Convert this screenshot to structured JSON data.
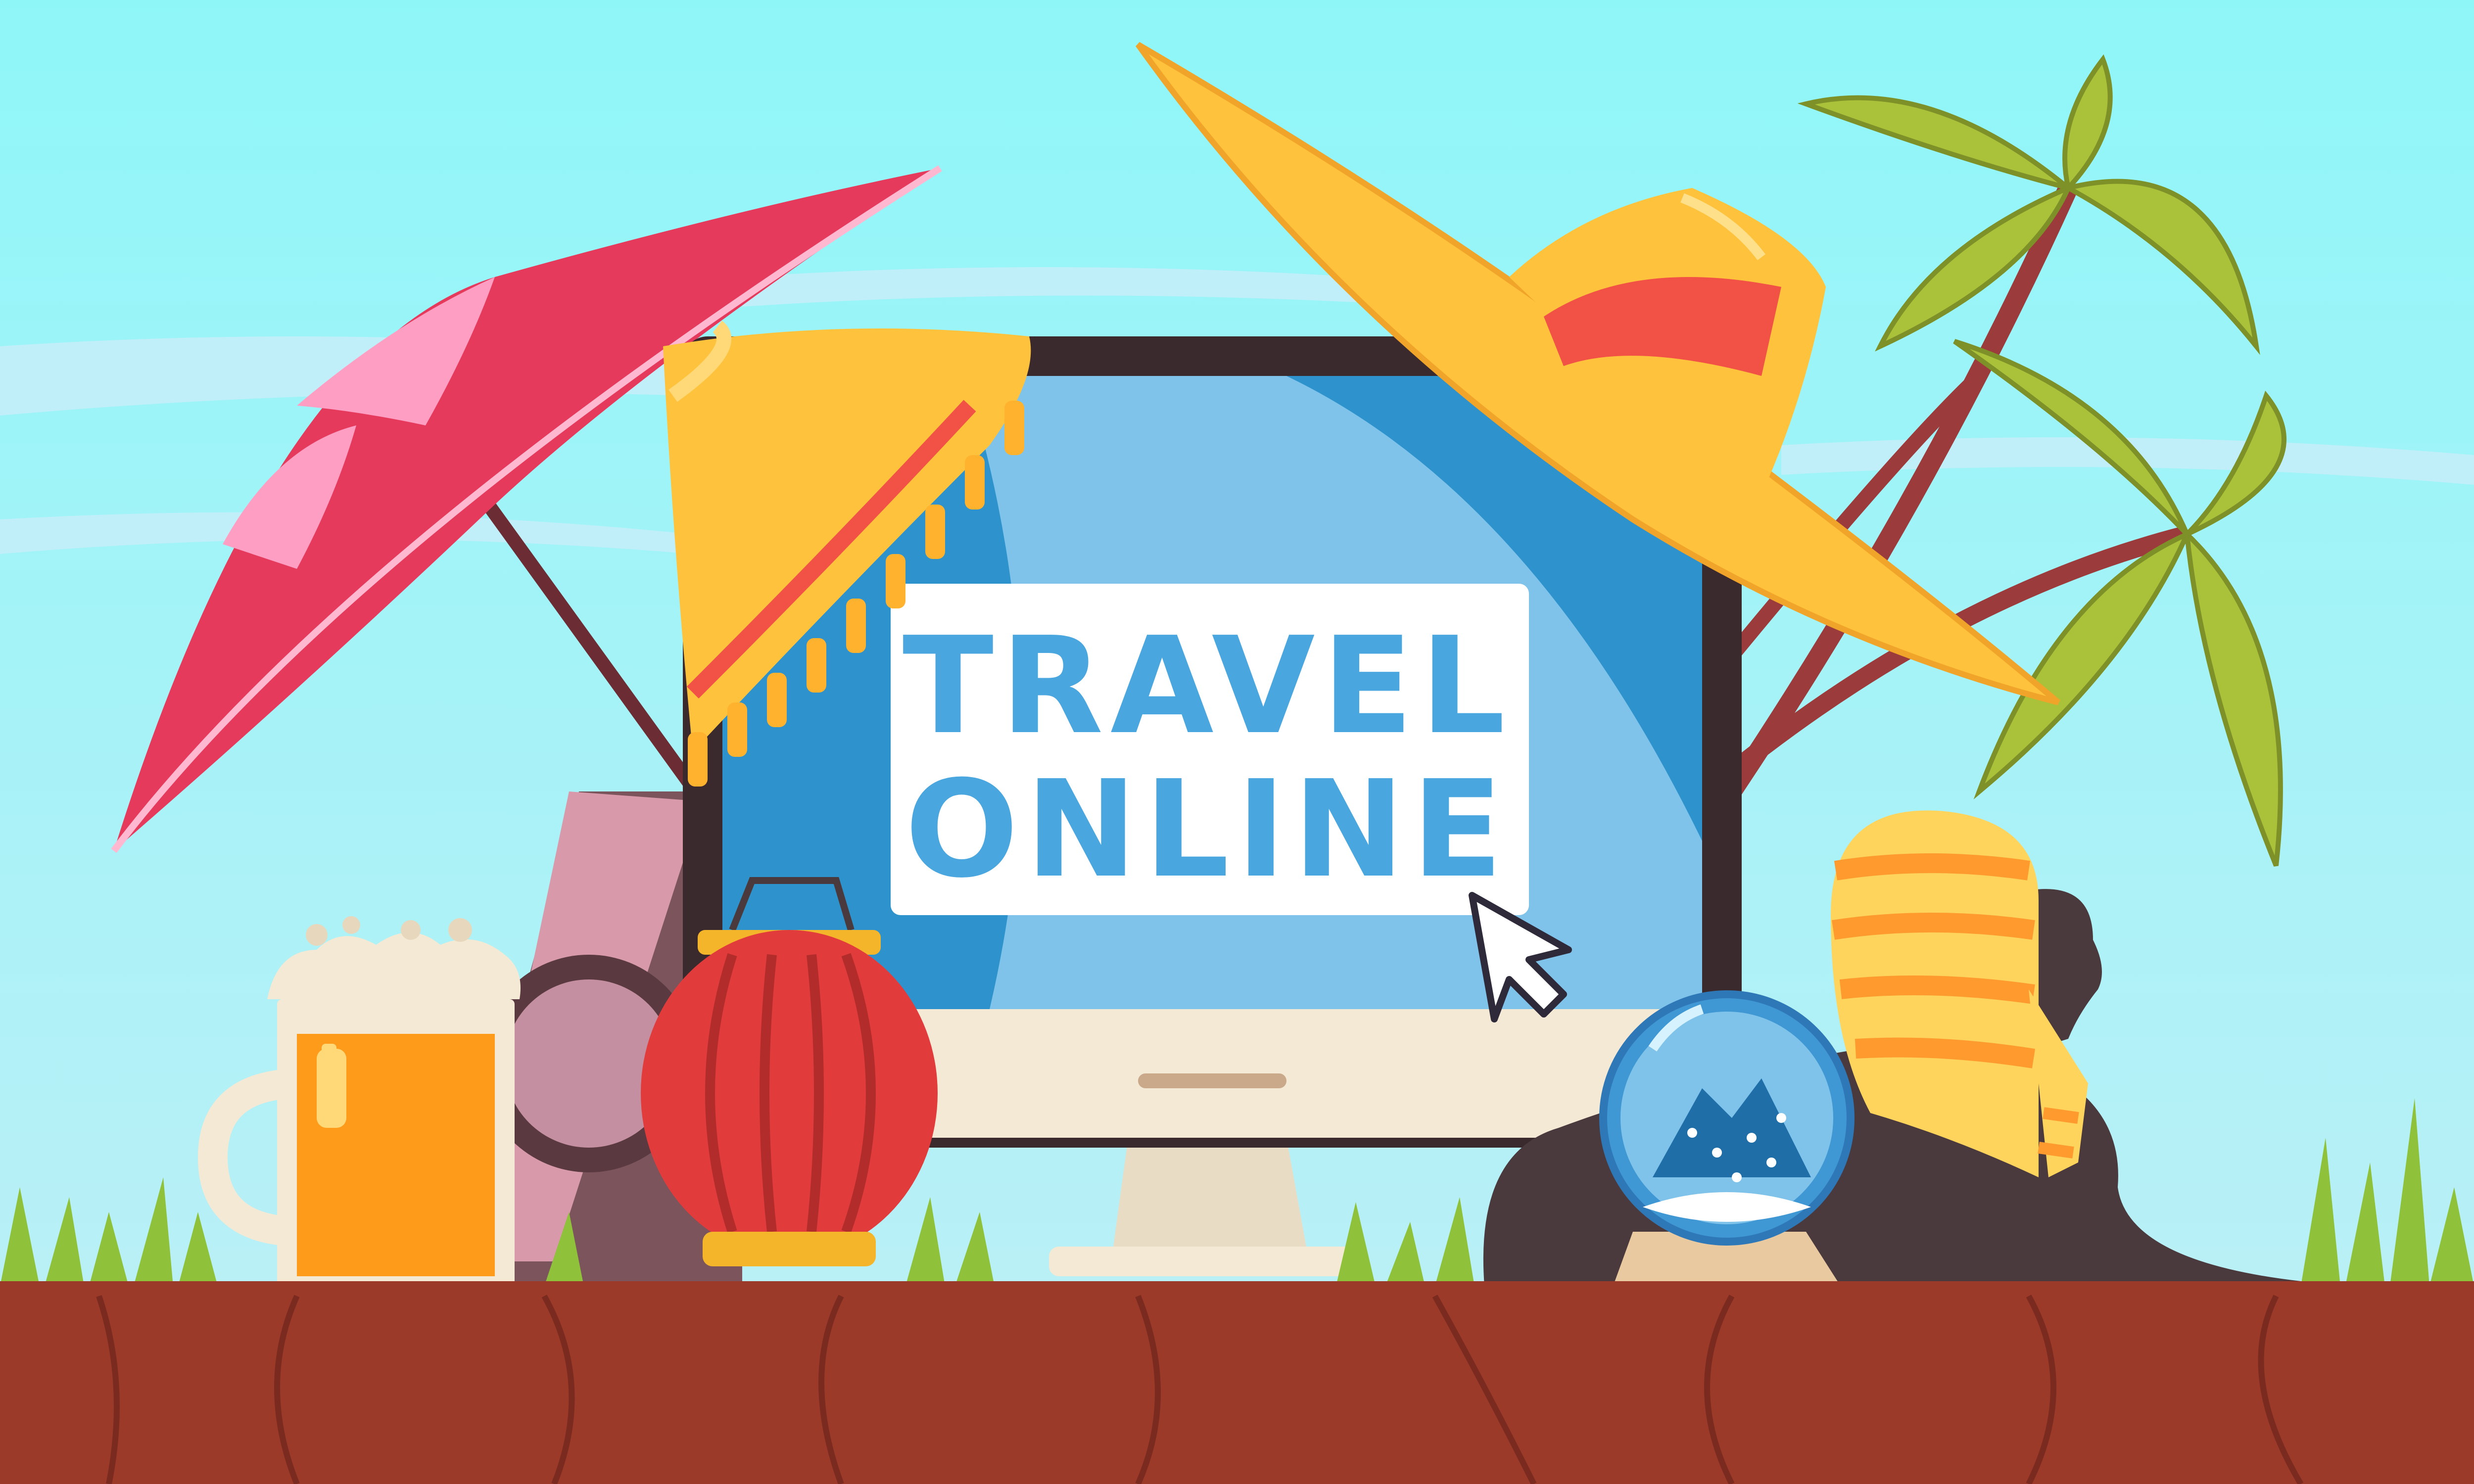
{
  "screen": {
    "line1": "TRAVEL",
    "line2": "ONLINE"
  },
  "colors": {
    "sky_top": "#8ff6f8",
    "sky_bottom": "#b9f0f6",
    "ground": "#9c3a2a",
    "ground_lines": "#7a2a1f",
    "grass": "#8fc23a",
    "monitor_frame": "#3b2a2d",
    "screen_blue": "#2e93cc",
    "screen_light": "#7fc3ea",
    "text_box": "#ffffff",
    "text_blue": "#4aa6de",
    "umbrella_red": "#e63a5c",
    "umbrella_pink": "#ff9ec3",
    "hat_yellow": "#ffc23d",
    "hat_band": "#f25245",
    "palm_leaf": "#a9c23a",
    "lantern_red": "#e23b3b",
    "beer_orange": "#ff9b1a",
    "globe_blue": "#3f97d3",
    "sphinx_dark": "#4a3a3d",
    "headdress_orange": "#ff9a2e"
  },
  "icons": {
    "cursor": "arrow-cursor-icon",
    "umbrella": "beach-umbrella-icon",
    "hat": "sun-hat-icon",
    "palm": "palm-tree-icon",
    "beer": "beer-mug-icon",
    "lantern": "chinese-lantern-icon",
    "globe": "snow-globe-icon",
    "sphinx": "sphinx-icon",
    "scarf": "tasseled-scarf-icon",
    "bag": "travel-bag-icon"
  }
}
